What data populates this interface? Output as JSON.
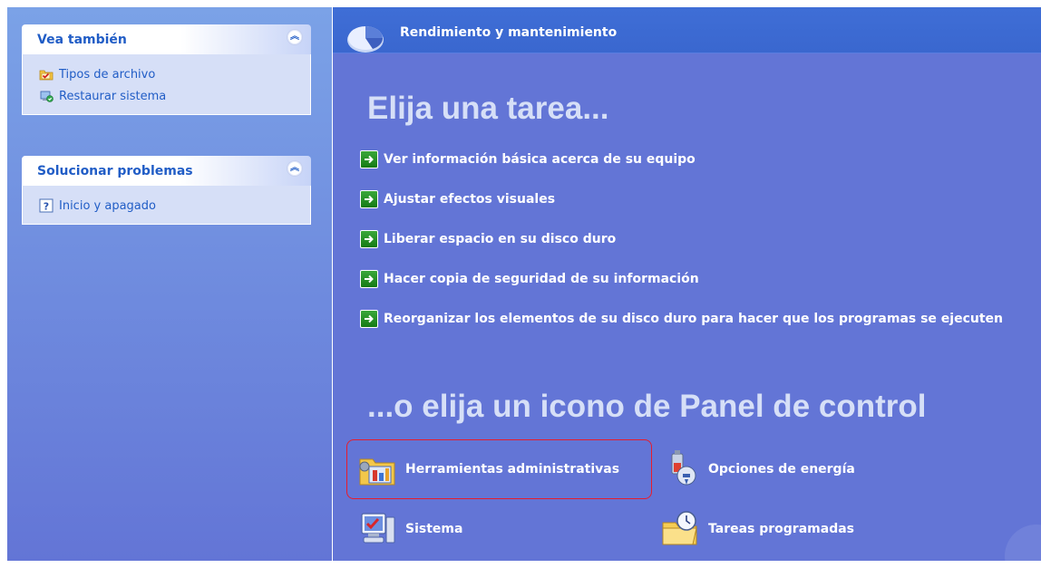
{
  "sidebar": {
    "see_also": {
      "title": "Vea también",
      "items": [
        {
          "label": "Tipos de archivo",
          "icon": "folder-check-icon"
        },
        {
          "label": "Restaurar sistema",
          "icon": "system-restore-icon"
        }
      ]
    },
    "troubleshoot": {
      "title": "Solucionar problemas",
      "items": [
        {
          "label": "Inicio y apagado",
          "icon": "help-icon"
        }
      ]
    }
  },
  "main": {
    "header_title": "Rendimiento y mantenimiento",
    "task_heading": "Elija una tarea...",
    "tasks": [
      "Ver información básica acerca de su equipo",
      "Ajustar efectos visuales",
      "Liberar espacio en su disco duro",
      "Hacer copia de seguridad de su información",
      "Reorganizar los elementos de su disco duro para hacer que los programas se ejecuten"
    ],
    "icon_heading": "...o elija un icono de Panel de control",
    "control_panel_icons": [
      {
        "label": "Herramientas administrativas",
        "icon": "admin-tools-icon"
      },
      {
        "label": "Opciones de energía",
        "icon": "power-options-icon"
      },
      {
        "label": "Sistema",
        "icon": "system-icon"
      },
      {
        "label": "Tareas programadas",
        "icon": "scheduled-tasks-icon"
      }
    ]
  },
  "colors": {
    "sidebar_title": "#215dc6",
    "content_bg": "#6375d6",
    "header_bg": "#3f6ed6",
    "highlight": "#e81c2c"
  }
}
